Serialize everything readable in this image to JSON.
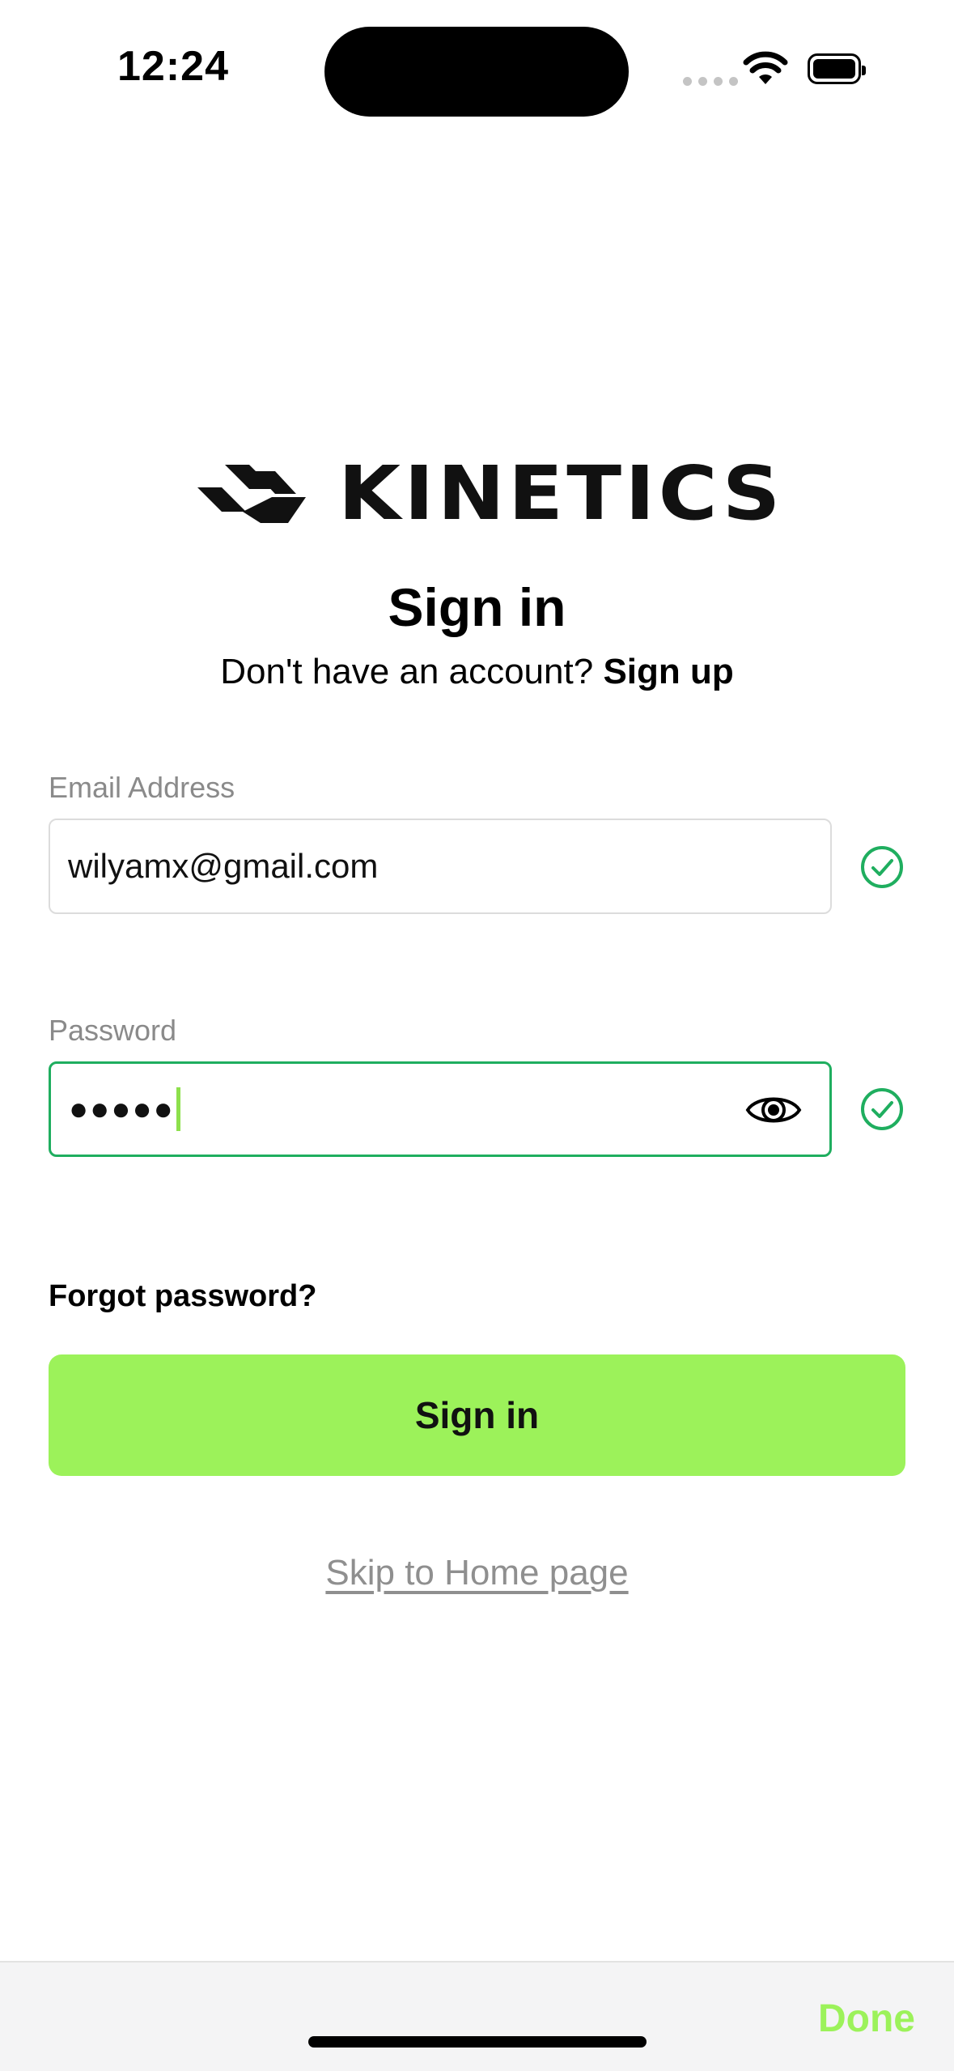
{
  "status_bar": {
    "time": "12:24"
  },
  "brand": {
    "name": "KINETICS"
  },
  "header": {
    "title": "Sign in",
    "prompt": "Don't have an account?",
    "signup_link": "Sign up"
  },
  "form": {
    "email": {
      "label": "Email Address",
      "value": "wilyamx@gmail.com",
      "valid": true
    },
    "password": {
      "label": "Password",
      "masked_value": "●●●●●",
      "valid": true
    }
  },
  "links": {
    "forgot_password": "Forgot password?",
    "skip": "Skip to Home page"
  },
  "buttons": {
    "sign_in": "Sign in",
    "done": "Done"
  },
  "colors": {
    "accent_green": "#9cf25a",
    "valid_green": "#1fae5f",
    "label_gray": "#8a8a8a"
  }
}
